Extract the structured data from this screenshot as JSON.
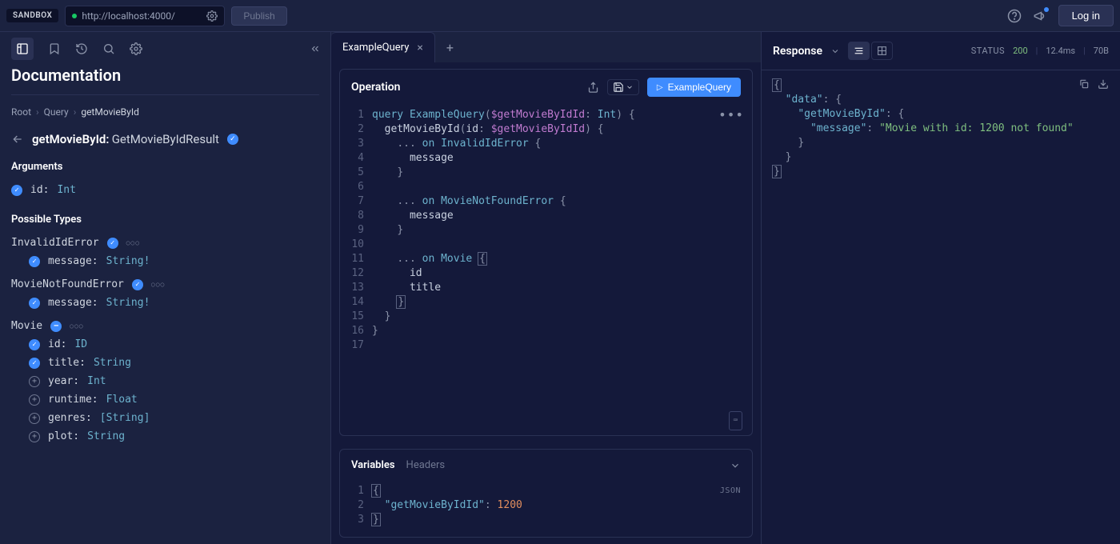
{
  "topbar": {
    "sandbox_label": "SANDBOX",
    "url": "http://localhost:4000/",
    "publish_label": "Publish",
    "login_label": "Log in"
  },
  "docs": {
    "title": "Documentation",
    "breadcrumbs": [
      "Root",
      "Query",
      "getMovieById"
    ],
    "field_name": "getMovieById:",
    "field_return": "GetMovieByIdResult",
    "arguments_label": "Arguments",
    "possible_types_label": "Possible Types",
    "args": [
      {
        "name": "id:",
        "type": "Int",
        "checked": true
      }
    ],
    "types": [
      {
        "name": "InvalidIdError",
        "checked": true,
        "fields": [
          {
            "name": "message:",
            "type": "String!",
            "checked": true
          }
        ]
      },
      {
        "name": "MovieNotFoundError",
        "checked": true,
        "fields": [
          {
            "name": "message:",
            "type": "String!",
            "checked": true
          }
        ]
      },
      {
        "name": "Movie",
        "partial": true,
        "fields": [
          {
            "name": "id:",
            "type": "ID",
            "checked": true
          },
          {
            "name": "title:",
            "type": "String",
            "checked": true
          },
          {
            "name": "year:",
            "type": "Int",
            "checked": false
          },
          {
            "name": "runtime:",
            "type": "Float",
            "checked": false
          },
          {
            "name": "genres:",
            "type": "[String]",
            "checked": false
          },
          {
            "name": "plot:",
            "type": "String",
            "checked": false
          }
        ]
      }
    ]
  },
  "tabs": {
    "active": "ExampleQuery"
  },
  "operation": {
    "title": "Operation",
    "run_label": "ExampleQuery",
    "code": {
      "l1_kw": "query",
      "l1_name": "ExampleQuery",
      "l1_var": "$getMovieByIdId",
      "l1_type": "Int",
      "l2_field": "getMovieById",
      "l2_arg": "id",
      "l2_var": "$getMovieByIdId",
      "l3_on": "on",
      "l3_type": "InvalidIdError",
      "l4_field": "message",
      "l7_type": "MovieNotFoundError",
      "l8_field": "message",
      "l11_type": "Movie",
      "l12_field": "id",
      "l13_field": "title"
    }
  },
  "variables": {
    "tab_vars": "Variables",
    "tab_headers": "Headers",
    "json_label": "JSON",
    "key": "\"getMovieByIdId\"",
    "val": "1200"
  },
  "response": {
    "title": "Response",
    "status_label": "STATUS",
    "status_code": "200",
    "timing": "12.4ms",
    "size": "70B",
    "data_key": "\"data\"",
    "field_key": "\"getMovieById\"",
    "msg_key": "\"message\"",
    "msg_val": "\"Movie with id: 1200 not found\""
  }
}
